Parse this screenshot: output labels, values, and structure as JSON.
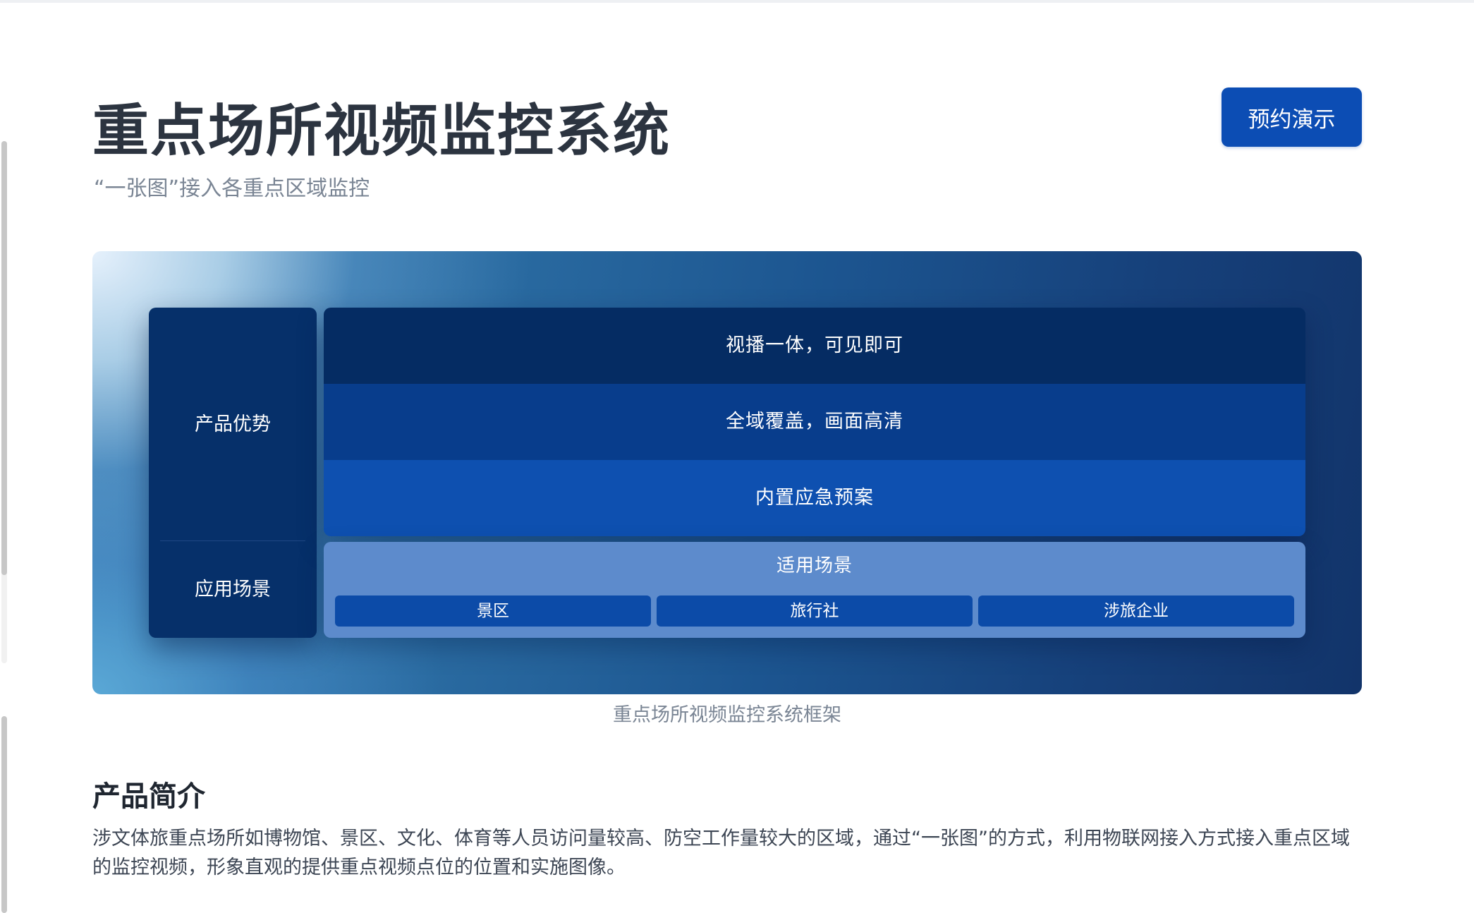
{
  "header": {
    "title": "重点场所视频监控系统",
    "subtitle": "“一张图”接入各重点区域监控",
    "demo_button_label": "预约演示"
  },
  "diagram": {
    "advantage_label": "产品优势",
    "scenario_label": "应用场景",
    "advantages": [
      "视播一体，可见即可",
      "全域覆盖，画面高清",
      "内置应急预案"
    ],
    "scenario_title": "适用场景",
    "scenarios": [
      "景区",
      "旅行社",
      "涉旅企业"
    ],
    "caption": "重点场所视频监控系统框架"
  },
  "intro": {
    "title": "产品简介",
    "body": "涉文体旅重点场所如博物馆、景区、文化、体育等人员访问量较高、防空工作量较大的区域，通过“一张图”的方式，利用物联网接入方式接入重点区域的监控视频，形象直观的提供重点视频点位的位置和实施图像。"
  },
  "colors": {
    "accent": "#0c4db4",
    "panel_dark": "#06306a",
    "row_1": "#052c63",
    "row_2": "#083d8c",
    "row_3": "#0e50b0",
    "scenario_box": "#5d8bcc",
    "chip": "#0c4ba8"
  }
}
